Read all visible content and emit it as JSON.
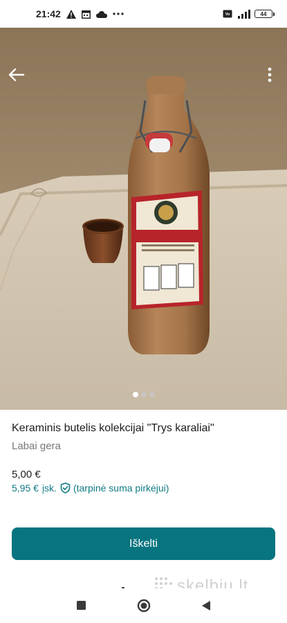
{
  "status_bar": {
    "time": "21:42",
    "left_icons": [
      "warning-icon",
      "calendar-icon",
      "cloud-icon",
      "more-dots-icon"
    ],
    "right_icons": [
      "volte-icon",
      "signal-icon"
    ],
    "battery_level": "44"
  },
  "gallery": {
    "image_count": 3,
    "active_index": 0
  },
  "listing": {
    "title": "Keraminis butelis kolekcijai \"Trys karaliai\"",
    "condition": "Labai gera",
    "price": "5,00 €",
    "buyer_total": "5,95 €",
    "buyer_total_suffix": "įsk.",
    "buyer_note": "(tarpinė suma pirkėjui)"
  },
  "actions": {
    "primary_label": "Iškelti"
  },
  "watermark": {
    "text": "skelbiu.lt"
  },
  "colors": {
    "accent": "#08747f",
    "link": "#107a84"
  }
}
